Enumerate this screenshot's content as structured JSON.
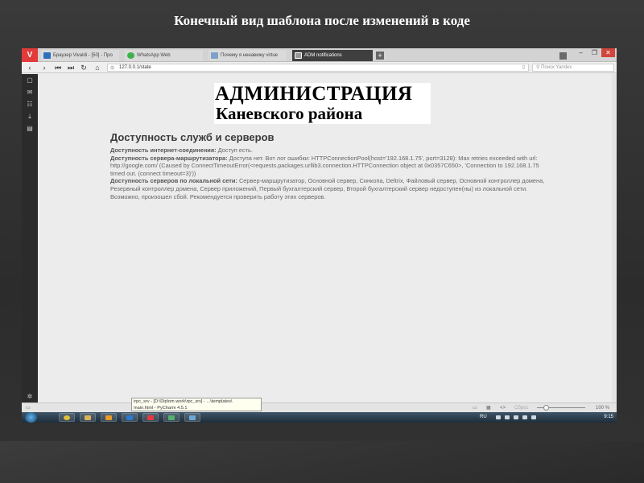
{
  "slide": {
    "title": "Конечный вид шаблона после изменений в коде"
  },
  "browser": {
    "tabs": [
      {
        "label": "Браузер Vivaldi - [50] - Про",
        "color": "#2d6fbf",
        "active": false
      },
      {
        "label": "WhatsApp Web",
        "color": "#3db34a",
        "active": false
      },
      {
        "label": "Почему я ненавижу virtue",
        "color": "#7ea1c7",
        "active": false
      },
      {
        "label": "ADM notifications",
        "color": "#999999",
        "active": true
      }
    ],
    "window_controls": [
      "minimize-icon",
      "maximize-icon",
      "close-icon"
    ],
    "nav_icons": [
      "back-icon",
      "forward-icon",
      "rewind-icon",
      "fast-forward-icon",
      "reload-icon",
      "home-icon"
    ],
    "url": "127.0.0.1/state",
    "search_placeholder": "Поиск Yandex",
    "side_panel_icons": [
      "bookmark-icon",
      "mail-icon",
      "contacts-icon",
      "download-icon",
      "notes-icon",
      "settings-icon"
    ]
  },
  "page": {
    "logo_line1": "АДМИНИСТРАЦИЯ",
    "logo_line2": "Каневского района",
    "heading": "Доступность служб и серверов",
    "internet_label": "Доступность интернет-соединения:",
    "internet_value": "Доступ есть.",
    "router_label": "Доступность сервера-маршрутизатора:",
    "router_value": "Доступа нет. Вот лог ошибки: HTTPConnectionPool(host='192.168.1.75', port=3128): Max retries exceeded with url: http://google.com/ (Caused by ConnectTimeoutError(<requests.packages.urllib3.connection.HTTPConnection object at 0x0357C650>, 'Connection to 192.168.1.75 timed out. (connect timeout=3)'))",
    "local_label": "Доступность серверов по локальной сети:",
    "local_value": "Сервер-маршрутизатор, Основной сервер, Синкопа, Deltrix, Файловый сервер, Основной контроллер домена, Резервный контроллер домена, Сервер приложений, Первый бухгалтерский сервер, Второй бухгалтерский сервер недоступен(ны) из локальной сети. Возможно, произошел сбой. Рекомендуется проверить работу этих серверов."
  },
  "statusbar": {
    "reset_label": "Сброс",
    "zoom": "100 %"
  },
  "tooltip": {
    "line1": "irpc_srv - [D:\\Diplom work\\rpc_srv] - ...\\templates\\",
    "line2": "main.html - PyCharm 4.5.1"
  },
  "taskbar": {
    "apps": [
      {
        "name": "chrome-icon",
        "color": "#e0c13c"
      },
      {
        "name": "explorer-icon",
        "color": "#d9b25a"
      },
      {
        "name": "media-player-icon",
        "color": "#e89a2a"
      },
      {
        "name": "outlook-icon",
        "color": "#2a7ad0"
      },
      {
        "name": "vivaldi-icon",
        "color": "#e23b3b"
      },
      {
        "name": "pycharm-icon",
        "color": "#54b36b"
      },
      {
        "name": "app-icon",
        "color": "#6aa8d8"
      }
    ],
    "language": "RU",
    "clock": "9:15"
  }
}
